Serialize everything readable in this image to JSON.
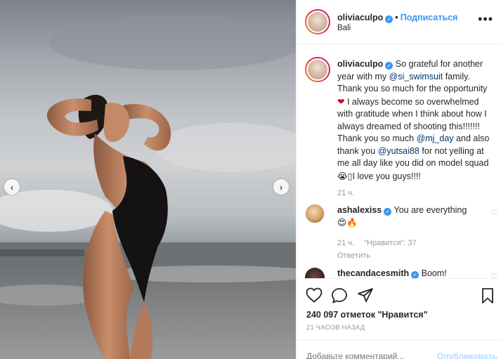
{
  "post": {
    "photo_alt": "Woman in black swimsuit on beach at sunset",
    "nav_prev_icon": "‹",
    "nav_next_icon": "›"
  },
  "header": {
    "username": "oliviaculpo",
    "verified_mark": "✓",
    "separator": "•",
    "follow_label": "Подписаться",
    "location": "Bali",
    "more_icon": "•••"
  },
  "caption": {
    "username": "oliviaculpo",
    "verified_mark": "✓",
    "t1": " So grateful for another year with my ",
    "mention1": "@si_swimsuit",
    "t2": " family. Thank you so much for the opportunity",
    "heart_emoji": "❤",
    "t3": " I always become so overwhelmed with gratitude when I think about how I always dreamed of shooting this!!!!!!! Thank you so much ",
    "mention2": "@mj_day",
    "t4": " and also thank you ",
    "mention3": "@yutsai88",
    "t5": " for not yelling at me all day like you did on model squad ",
    "emoji2": "😭",
    "glyph": "▯",
    "t6": "I love you guys!!!!",
    "time": "21 ч."
  },
  "comments": [
    {
      "username": "ashalexiss",
      "verified_mark": "✓",
      "text": "You are everything",
      "emojis": "😍🔥",
      "time": "21 ч.",
      "likes": "\"Нравится\": 37",
      "reply": "Ответить",
      "like_icon": "♡"
    },
    {
      "username": "thecandacesmith",
      "verified_mark": "✓",
      "text": "Boom!",
      "like_icon": "♡"
    }
  ],
  "actions": {
    "like_icon": "heart-outline",
    "comment_icon": "speech-bubble",
    "share_icon": "paper-plane",
    "save_icon": "bookmark"
  },
  "likes_text": "240 097 отметок \"Нравится\"",
  "timestamp": "21 ЧАСОВ НАЗАД",
  "add_comment": {
    "placeholder": "Добавьте комментарий...",
    "publish_label": "Опубликовать"
  },
  "colors": {
    "accent": "#3897f0",
    "mention": "#003569",
    "muted": "#999999",
    "heart": "#ed4956"
  }
}
